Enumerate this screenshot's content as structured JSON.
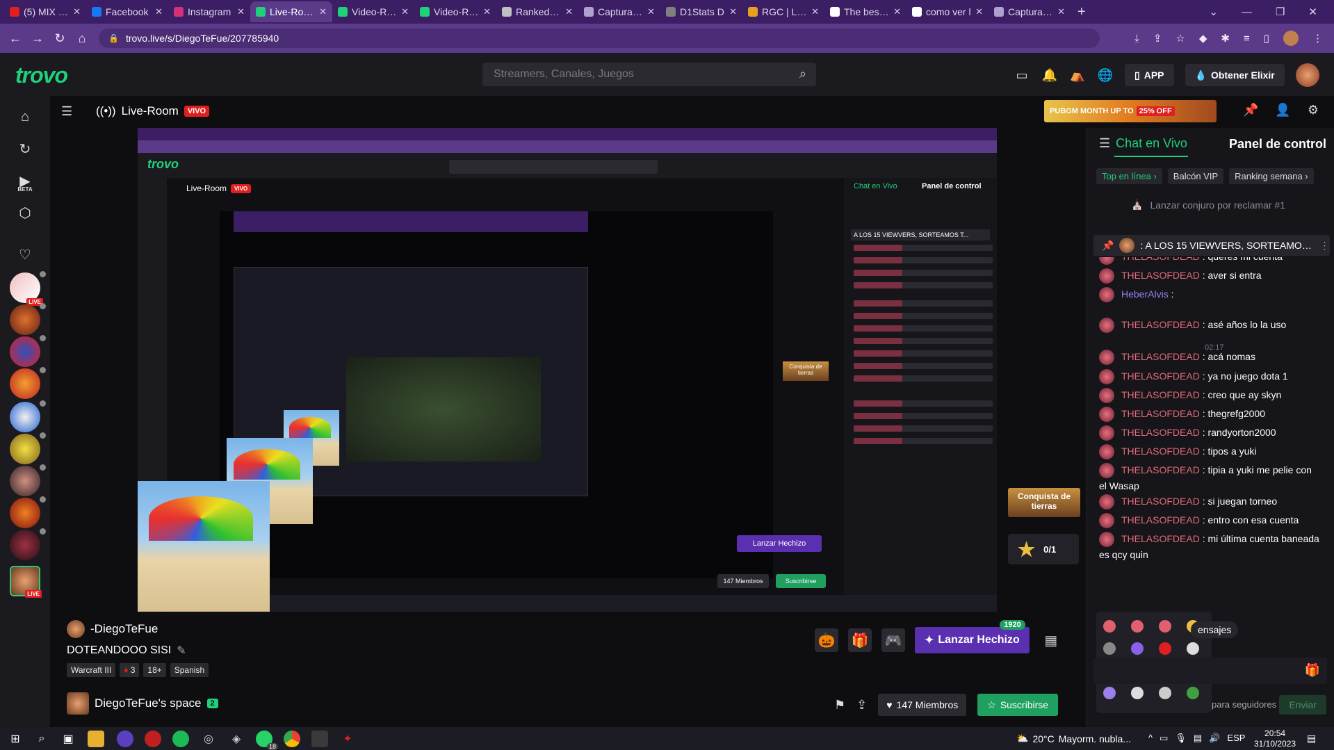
{
  "browser": {
    "tabs": [
      {
        "label": "(5) MIX LO",
        "favicon_color": "#e02020"
      },
      {
        "label": "Facebook",
        "favicon_color": "#1877f2"
      },
      {
        "label": "Instagram",
        "favicon_color": "#d6307a"
      },
      {
        "label": "Live-Room",
        "favicon_color": "#1fd17a",
        "active": true
      },
      {
        "label": "Video-Roo",
        "favicon_color": "#1fd17a"
      },
      {
        "label": "Video-Roo",
        "favicon_color": "#1fd17a"
      },
      {
        "label": "Ranked Ga",
        "favicon_color": "#c0c0c0"
      },
      {
        "label": "Captura de",
        "favicon_color": "#b0a0d0"
      },
      {
        "label": "D1Stats D",
        "favicon_color": "#808080"
      },
      {
        "label": "RGC | Logi",
        "favicon_color": "#e8a020"
      },
      {
        "label": "The best st",
        "favicon_color": "#ffffff"
      },
      {
        "label": "como ver l",
        "favicon_color": "#ffffff"
      },
      {
        "label": "Captura de",
        "favicon_color": "#b0a0d0"
      }
    ],
    "url": "trovo.live/s/DiegoTeFue/207785940"
  },
  "header": {
    "logo": "trovo",
    "search_placeholder": "Streamers, Canales, Juegos",
    "app_label": "APP",
    "elixir_label": "Obtener Elixir"
  },
  "sidebar": {
    "beta_label": "BETA",
    "live_label": "LIVE"
  },
  "room": {
    "title": "Live-Room",
    "live_badge": "VIVO",
    "banner_text": "PUBGM MONTH UP TO",
    "banner_percent": "25% OFF"
  },
  "stream": {
    "streamer": "-DiegoTeFue",
    "title": "DOTEANDOOO SISI",
    "tags": [
      "Warcraft III",
      "3",
      "18+",
      "Spanish"
    ],
    "space_name": "DiegoTeFue's space",
    "space_badge": "2",
    "spell_label": "Lanzar Hechizo",
    "spell_badge": "1920",
    "members_label": "147 Miembros",
    "subscribe_label": "Suscribirse"
  },
  "widgets": {
    "conquista_label": "Conquista de tierras",
    "star_count": "0/1"
  },
  "nested": {
    "logo": "trovo",
    "room_title": "Live-Room",
    "live_badge": "VIVO",
    "chat_tab": "Chat en Vivo",
    "panel_tab": "Panel de control",
    "spell_label": "Lanzar Hechizo",
    "members_label": "147 Miembros",
    "subscribe_label": "Suscribirse",
    "conquista_label": "Conquista de tierras",
    "pinned": "A LOS 15 VIEWVERS, SORTEAMOS T..."
  },
  "chat": {
    "tab_label": "Chat en Vivo",
    "panel_label": "Panel de control",
    "filters": [
      "Top en línea",
      "Balcón VIP",
      "Ranking semana"
    ],
    "conjuro": "Lanzar conjuro por reclamar #1",
    "pinned": ": A LOS 15 VIEWVERS, SORTEAMOS T...",
    "messages": [
      {
        "user": "THELASOFDEAD",
        "text": ": queres mi cuenta"
      },
      {
        "user": "THELASOFDEAD",
        "text": ": aver si entra"
      },
      {
        "user": "HeberAlvis",
        "text": ":",
        "purple": true
      },
      {
        "user": "THELASOFDEAD",
        "text": ": asé años lo la uso"
      },
      {
        "user": "THELASOFDEAD",
        "text": ": acá nomas"
      },
      {
        "user": "THELASOFDEAD",
        "text": ": ya no juego dota 1"
      },
      {
        "user": "THELASOFDEAD",
        "text": ": creo que ay skyn"
      },
      {
        "user": "THELASOFDEAD",
        "text": ": thegrefg2000"
      },
      {
        "user": "THELASOFDEAD",
        "text": ": randyorton2000"
      },
      {
        "user": "THELASOFDEAD",
        "text": ": tipos a yuki"
      },
      {
        "user": "THELASOFDEAD",
        "text": ": tipia a yuki me pelie con el Wasap"
      },
      {
        "user": "THELASOFDEAD",
        "text": ": si juegan torneo"
      },
      {
        "user": "THELASOFDEAD",
        "text": ": entro con esa cuenta"
      },
      {
        "user": "THELASOFDEAD",
        "text": ": mi última cuenta baneada es qcy quin"
      }
    ],
    "timestamp": "02:17",
    "new_messages": "ensajes",
    "footer_label": "para seguidores",
    "send_label": "Enviar"
  },
  "taskbar": {
    "weather_temp": "20°C",
    "weather_text": "Mayorm. nubla...",
    "lang": "ESP",
    "time": "20:54",
    "date": "31/10/2023",
    "whatsapp_badge": "18"
  }
}
